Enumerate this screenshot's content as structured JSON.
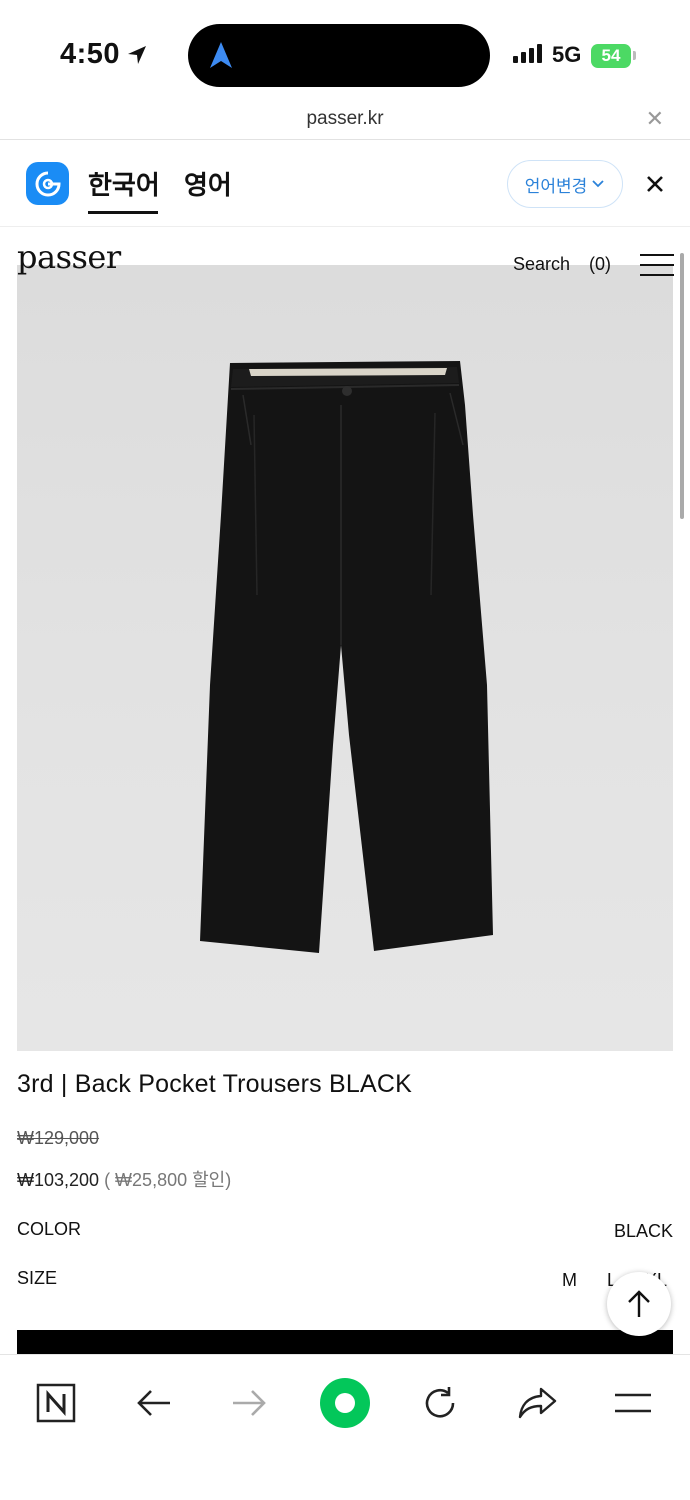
{
  "status_bar": {
    "time": "4:50",
    "network": "5G",
    "battery": "54"
  },
  "browser": {
    "url": "passer.kr"
  },
  "translate_bar": {
    "tabs": [
      "한국어",
      "영어"
    ],
    "change_button": "언어변경"
  },
  "site": {
    "logo": "passer",
    "search_label": "Search",
    "cart_count": "(0)"
  },
  "product": {
    "title": "3rd | Back Pocket Trousers BLACK",
    "original_price": "₩129,000",
    "sale_price": "₩103,200",
    "discount_text": " ( ₩25,800 할인)",
    "color_label": "COLOR",
    "color_value": "BLACK",
    "size_label": "SIZE",
    "sizes": [
      "M",
      "L",
      "XL"
    ]
  },
  "colors": {
    "green_button": "#03c75a",
    "papago_blue": "#1a8cf5",
    "battery_green": "#4cd964"
  }
}
